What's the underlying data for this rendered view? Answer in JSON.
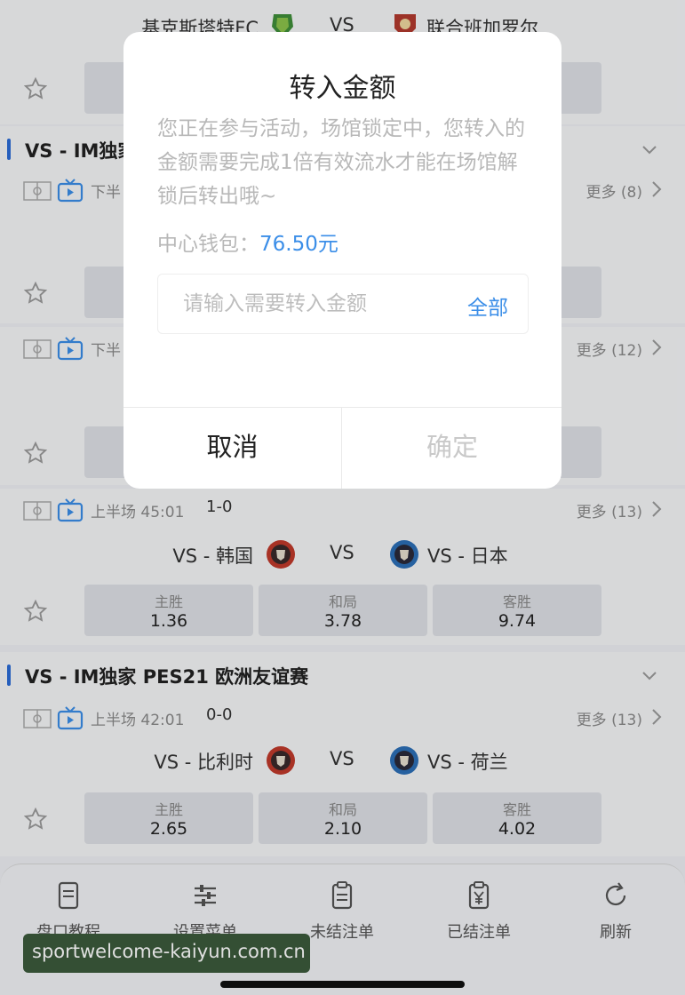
{
  "top_match": {
    "home": "基克斯塔特FC",
    "vs": "VS",
    "away": "联合班加罗尔"
  },
  "league_title": "VS - IM独家 PES21 欧洲友谊赛",
  "league_title_partial": "VS - IM独家",
  "partial_rows": [
    {
      "time": "下半",
      "more": "更多 (8)"
    },
    {
      "time": "下半",
      "more": "更多 (12)"
    }
  ],
  "matches": [
    {
      "time": "上半场 45:01",
      "score": "1-0",
      "home": "VS - 韩国",
      "vs": "VS",
      "away": "VS - 日本",
      "more": "更多 (13)",
      "odds": [
        {
          "label": "主胜",
          "value": "1.36"
        },
        {
          "label": "和局",
          "value": "3.78"
        },
        {
          "label": "客胜",
          "value": "9.74"
        }
      ]
    },
    {
      "time": "上半场 42:01",
      "score": "0-0",
      "home": "VS - 比利时",
      "vs": "VS",
      "away": "VS - 荷兰",
      "more": "更多 (13)",
      "odds": [
        {
          "label": "主胜",
          "value": "2.65"
        },
        {
          "label": "和局",
          "value": "2.10"
        },
        {
          "label": "客胜",
          "value": "4.02"
        }
      ]
    }
  ],
  "nav": [
    {
      "label": "盘口教程",
      "icon": "document-icon"
    },
    {
      "label": "设置菜单",
      "icon": "sliders-icon"
    },
    {
      "label": "未结注单",
      "icon": "clipboard-icon"
    },
    {
      "label": "已结注单",
      "icon": "clipboard-yen-icon"
    },
    {
      "label": "刷新",
      "icon": "refresh-icon"
    }
  ],
  "watermark": "sportwelcome-kaiyun.com.cn",
  "dialog": {
    "title": "转入金额",
    "description": "您正在参与活动，场馆锁定中，您转入的金额需要完成1倍有效流水才能在场馆解锁后转出哦~",
    "wallet_label": "中心钱包：",
    "wallet_amount": "76.50元",
    "input_placeholder": "请输入需要转入金额",
    "all_label": "全部",
    "cancel_label": "取消",
    "confirm_label": "确定"
  },
  "colors": {
    "accent": "#3b8ee8",
    "league_bar": "#2b6cd6",
    "home_badge": "#c0392b",
    "away_badge": "#2c6fb7"
  }
}
